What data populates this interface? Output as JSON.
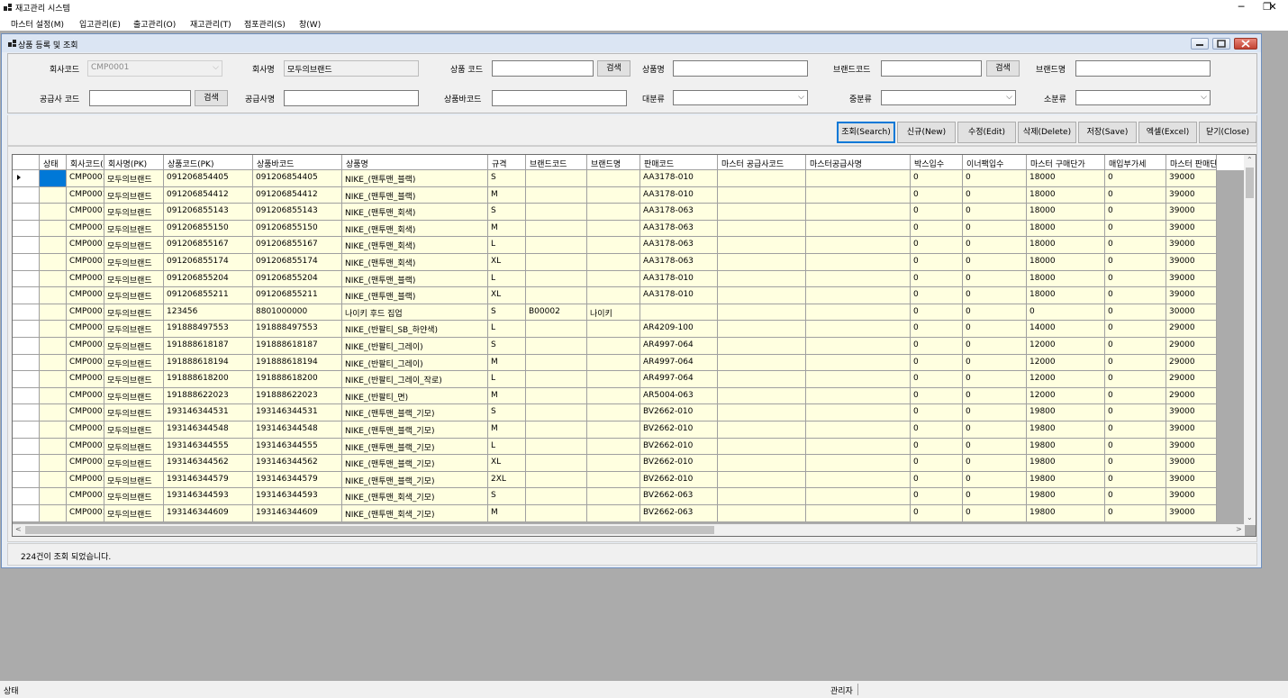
{
  "window": {
    "title": "재고관리 시스템",
    "minimize": "─",
    "maximize": "❐",
    "close": "✕"
  },
  "menu": [
    "마스터 설정(M)",
    "입고관리(E)",
    "출고관리(O)",
    "재고관리(T)",
    "점포관리(S)",
    "창(W)"
  ],
  "child": {
    "title": "상품 등록 및 조회"
  },
  "form": {
    "company_code_label": "회사코드",
    "company_code_value": "CMP0001",
    "company_name_label": "회사명",
    "company_name_value": "모두의브랜드",
    "product_code_label": "상품 코드",
    "product_name_label": "상품명",
    "brand_code_label": "브랜드코드",
    "brand_name_label": "브랜드명",
    "supplier_code_label": "공급사 코드",
    "supplier_name_label": "공급사명",
    "barcode_label": "상품바코드",
    "major_label": "대분류",
    "middle_label": "중분류",
    "minor_label": "소분류",
    "search_btn": "검색"
  },
  "actions": {
    "search": "조회(Search)",
    "new": "신규(New)",
    "edit": "수정(Edit)",
    "delete": "삭제(Delete)",
    "save": "저장(Save)",
    "excel": "엑셀(Excel)",
    "close": "닫기(Close)"
  },
  "grid": {
    "columns": [
      "상태",
      "회사코드(PK)",
      "회사명(PK)",
      "상품코드(PK)",
      "상품바코드",
      "상품명",
      "규격",
      "브랜드코드",
      "브랜드명",
      "판매코드",
      "마스터 공급사코드",
      "마스터공급사명",
      "박스입수",
      "이너팩입수",
      "마스터 구매단가",
      "매입부가세",
      "마스터 판매단가"
    ],
    "rows": [
      [
        "",
        "CMP0001",
        "모두의브랜드",
        "091206854405",
        "091206854405",
        "NIKE_(맨투맨_블랙)",
        "S",
        "",
        "",
        "AA3178-010",
        "",
        "",
        "0",
        "0",
        "18000",
        "0",
        "39000"
      ],
      [
        "",
        "CMP0001",
        "모두의브랜드",
        "091206854412",
        "091206854412",
        "NIKE_(맨투맨_블랙)",
        "M",
        "",
        "",
        "AA3178-010",
        "",
        "",
        "0",
        "0",
        "18000",
        "0",
        "39000"
      ],
      [
        "",
        "CMP0001",
        "모두의브랜드",
        "091206855143",
        "091206855143",
        "NIKE_(맨투맨_회색)",
        "S",
        "",
        "",
        "AA3178-063",
        "",
        "",
        "0",
        "0",
        "18000",
        "0",
        "39000"
      ],
      [
        "",
        "CMP0001",
        "모두의브랜드",
        "091206855150",
        "091206855150",
        "NIKE_(맨투맨_회색)",
        "M",
        "",
        "",
        "AA3178-063",
        "",
        "",
        "0",
        "0",
        "18000",
        "0",
        "39000"
      ],
      [
        "",
        "CMP0001",
        "모두의브랜드",
        "091206855167",
        "091206855167",
        "NIKE_(맨투맨_회색)",
        "L",
        "",
        "",
        "AA3178-063",
        "",
        "",
        "0",
        "0",
        "18000",
        "0",
        "39000"
      ],
      [
        "",
        "CMP0001",
        "모두의브랜드",
        "091206855174",
        "091206855174",
        "NIKE_(맨투맨_회색)",
        "XL",
        "",
        "",
        "AA3178-063",
        "",
        "",
        "0",
        "0",
        "18000",
        "0",
        "39000"
      ],
      [
        "",
        "CMP0001",
        "모두의브랜드",
        "091206855204",
        "091206855204",
        "NIKE_(맨투맨_블랙)",
        "L",
        "",
        "",
        "AA3178-010",
        "",
        "",
        "0",
        "0",
        "18000",
        "0",
        "39000"
      ],
      [
        "",
        "CMP0001",
        "모두의브랜드",
        "091206855211",
        "091206855211",
        "NIKE_(맨투맨_블랙)",
        "XL",
        "",
        "",
        "AA3178-010",
        "",
        "",
        "0",
        "0",
        "18000",
        "0",
        "39000"
      ],
      [
        "",
        "CMP0001",
        "모두의브랜드",
        "123456",
        "8801000000",
        "나이키 후드 집업",
        "S",
        "B00002",
        "나이키",
        "",
        "",
        "",
        "0",
        "0",
        "0",
        "0",
        "30000"
      ],
      [
        "",
        "CMP0001",
        "모두의브랜드",
        "191888497553",
        "191888497553",
        "NIKE_(반팔티_SB_하얀색)",
        "L",
        "",
        "",
        "AR4209-100",
        "",
        "",
        "0",
        "0",
        "14000",
        "0",
        "29000"
      ],
      [
        "",
        "CMP0001",
        "모두의브랜드",
        "191888618187",
        "191888618187",
        "NIKE_(반팔티_그레이)",
        "S",
        "",
        "",
        "AR4997-064",
        "",
        "",
        "0",
        "0",
        "12000",
        "0",
        "29000"
      ],
      [
        "",
        "CMP0001",
        "모두의브랜드",
        "191888618194",
        "191888618194",
        "NIKE_(반팔티_그레이)",
        "M",
        "",
        "",
        "AR4997-064",
        "",
        "",
        "0",
        "0",
        "12000",
        "0",
        "29000"
      ],
      [
        "",
        "CMP0001",
        "모두의브랜드",
        "191888618200",
        "191888618200",
        "NIKE_(반팔티_그레이_작로)",
        "L",
        "",
        "",
        "AR4997-064",
        "",
        "",
        "0",
        "0",
        "12000",
        "0",
        "29000"
      ],
      [
        "",
        "CMP0001",
        "모두의브랜드",
        "191888622023",
        "191888622023",
        "NIKE_(반팔티_면)",
        "M",
        "",
        "",
        "AR5004-063",
        "",
        "",
        "0",
        "0",
        "12000",
        "0",
        "29000"
      ],
      [
        "",
        "CMP0001",
        "모두의브랜드",
        "193146344531",
        "193146344531",
        "NIKE_(맨투맨_블랙_기모)",
        "S",
        "",
        "",
        "BV2662-010",
        "",
        "",
        "0",
        "0",
        "19800",
        "0",
        "39000"
      ],
      [
        "",
        "CMP0001",
        "모두의브랜드",
        "193146344548",
        "193146344548",
        "NIKE_(맨투맨_블랙_기모)",
        "M",
        "",
        "",
        "BV2662-010",
        "",
        "",
        "0",
        "0",
        "19800",
        "0",
        "39000"
      ],
      [
        "",
        "CMP0001",
        "모두의브랜드",
        "193146344555",
        "193146344555",
        "NIKE_(맨투맨_블랙_기모)",
        "L",
        "",
        "",
        "BV2662-010",
        "",
        "",
        "0",
        "0",
        "19800",
        "0",
        "39000"
      ],
      [
        "",
        "CMP0001",
        "모두의브랜드",
        "193146344562",
        "193146344562",
        "NIKE_(맨투맨_블랙_기모)",
        "XL",
        "",
        "",
        "BV2662-010",
        "",
        "",
        "0",
        "0",
        "19800",
        "0",
        "39000"
      ],
      [
        "",
        "CMP0001",
        "모두의브랜드",
        "193146344579",
        "193146344579",
        "NIKE_(맨투맨_블랙_기모)",
        "2XL",
        "",
        "",
        "BV2662-010",
        "",
        "",
        "0",
        "0",
        "19800",
        "0",
        "39000"
      ],
      [
        "",
        "CMP0001",
        "모두의브랜드",
        "193146344593",
        "193146344593",
        "NIKE_(맨투맨_회색_기모)",
        "S",
        "",
        "",
        "BV2662-063",
        "",
        "",
        "0",
        "0",
        "19800",
        "0",
        "39000"
      ],
      [
        "",
        "CMP0001",
        "모두의브랜드",
        "193146344609",
        "193146344609",
        "NIKE_(맨투맨_회색_기모)",
        "M",
        "",
        "",
        "BV2662-063",
        "",
        "",
        "0",
        "0",
        "19800",
        "0",
        "39000"
      ]
    ]
  },
  "status_message": "224건이 조회 되었습니다.",
  "statusbar": {
    "left": "상태",
    "user": "관리자"
  }
}
